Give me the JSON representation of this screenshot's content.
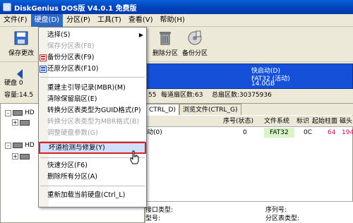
{
  "window": {
    "title": "DiskGenius DOS版 V4.0.1 免费版"
  },
  "menubar": [
    {
      "label": "文件(F)"
    },
    {
      "label": "硬盘(D)",
      "active": true
    },
    {
      "label": "分区(P)"
    },
    {
      "label": "工具(T)"
    },
    {
      "label": "查看(V)"
    },
    {
      "label": "帮助(H)"
    }
  ],
  "toolbar": {
    "save_label": "保存更改",
    "delete_label": "删除分区",
    "backup_label": "备份分区"
  },
  "disk": {
    "label": "硬盘 0",
    "capacity_label": "容量:14.5",
    "info_cyl_tail": "55",
    "sectors_per_track": "每道扇区数:63",
    "total_sectors": "总扇区数:30375936"
  },
  "partition_map": {
    "name": "快启动(D)",
    "fs": "FAT32 (活动)",
    "size": "14.0GB"
  },
  "tree": [
    {
      "label": "HD",
      "expand": "-"
    },
    {
      "label": "",
      "expand": "+"
    },
    {
      "label": "HD",
      "expand": "-"
    },
    {
      "label": "",
      "expand": "+"
    }
  ],
  "tabs": [
    "CTRL_D)",
    "浏览文件(CTRL_G)"
  ],
  "table": {
    "headers": [
      "序号(状态)",
      "文件系统",
      "标识",
      "起始柱面",
      "磁头"
    ],
    "row": {
      "name": "动(0)",
      "index": "0",
      "fs": "FAT32",
      "id": "0C",
      "start_cyl": "64",
      "head": "194"
    }
  },
  "details": {
    "iface_label": "接口类型:",
    "model_label": "型号:",
    "serial_label": "序列号:",
    "partstyle_label": "分区表类型:"
  },
  "dropdown": {
    "items": [
      {
        "label": "选择(S)",
        "submenu": true,
        "disabled": false
      },
      {
        "label": "保存分区表(F8)",
        "disabled": true
      },
      {
        "label": "备份分区表(F9)",
        "disabled": false,
        "icon": "backup-table-icon"
      },
      {
        "label": "还原分区表(F10)",
        "disabled": false,
        "icon": "restore-table-icon"
      },
      {
        "sep": true
      },
      {
        "label": "重建主引导记录(MBR)(M)",
        "disabled": false
      },
      {
        "label": "清除保留扇区(E)",
        "disabled": false
      },
      {
        "label": "转换分区表类型为GUID格式(P)",
        "disabled": false
      },
      {
        "label": "转换分区表类型为MBR格式(B)",
        "disabled": true
      },
      {
        "label": "调整硬盘参数(G)",
        "disabled": true
      },
      {
        "sep": true
      },
      {
        "label": "坏道检测与修复(Y)",
        "disabled": false,
        "highlight": true
      },
      {
        "sep": true
      },
      {
        "label": "快速分区(F6)",
        "disabled": false
      },
      {
        "label": "删除所有分区(A)",
        "disabled": false
      },
      {
        "sep": true
      },
      {
        "label": "重新加载当前硬盘(Ctrl_L)",
        "disabled": false
      }
    ]
  },
  "colors": {
    "title_blue": "#0a5fd8",
    "partition_blue": "#1550d8",
    "highlight_border": "#e02020",
    "fs_cell_green": "#d8f5c8",
    "red_numbers": "#c01060"
  }
}
